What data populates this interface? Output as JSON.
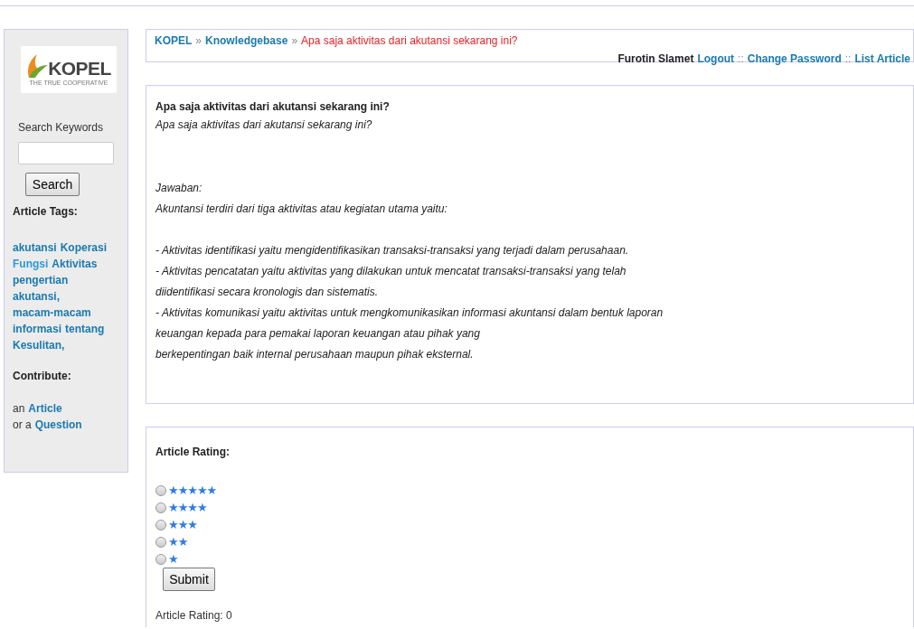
{
  "sidebar": {
    "logo": {
      "name": "KOPEL",
      "tagline": "THE TRUE COOPERATIVE"
    },
    "search": {
      "label": "Search Keywords",
      "button": "Search"
    },
    "tags_heading": "Article Tags:",
    "tags": [
      {
        "label": "akutansi",
        "color": "#1a7ab0"
      },
      {
        "label": "Koperasi",
        "color": "#1a7ab0"
      },
      {
        "label": "Fungsi",
        "color": "#2b9ad6"
      },
      {
        "label": "Aktivitas",
        "color": "#1a7ab0"
      },
      {
        "label": "pengertian",
        "color": "#1a7ab0"
      },
      {
        "label": "akutansi,",
        "color": "#1a7ab0"
      },
      {
        "label": "macam-macam",
        "color": "#1a7ab0"
      },
      {
        "label": "informasi",
        "color": "#1a7ab0"
      },
      {
        "label": "tentang",
        "color": "#1a7ab0"
      },
      {
        "label": "Kesulitan,",
        "color": "#1a7ab0"
      }
    ],
    "contribute_heading": "Contribute:",
    "contribute": [
      {
        "prefix": "an",
        "link": "Article"
      },
      {
        "prefix": "or a",
        "link": "Question"
      }
    ]
  },
  "breadcrumb": [
    {
      "label": "KOPEL",
      "kind": "link"
    },
    {
      "label": "»",
      "kind": "sep"
    },
    {
      "label": "Knowledgebase",
      "kind": "link"
    },
    {
      "label": "»",
      "kind": "sep"
    },
    {
      "label": "Apa saja aktivitas dari akutansi sekarang ini?",
      "kind": "current"
    }
  ],
  "user_bar": [
    {
      "label": "Furotin Slamet",
      "kind": "user"
    },
    {
      "label": "Logout",
      "kind": "link"
    },
    {
      "label": "::",
      "kind": "sep"
    },
    {
      "label": "Change Password",
      "kind": "link"
    },
    {
      "label": "::",
      "kind": "sep"
    },
    {
      "label": "List Article",
      "kind": "link"
    }
  ],
  "article": {
    "title": "Apa saja aktivitas dari akutansi sekarang ini?",
    "question": "Apa saja aktivitas dari akutansi sekarang ini?",
    "answer_intro": [
      "Jawaban:",
      "Akuntansi terdiri dari tiga aktivitas atau kegiatan utama yaitu:"
    ],
    "answer_lines": [
      "- Aktivitas identifikasi yaitu mengidentifikasikan transaksi-transaksi yang terjadi dalam perusahaan.",
      "- Aktivitas pencatatan yaitu aktivitas yang dilakukan untuk mencatat transaksi-transaksi yang telah",
      "diidentifikasi secara kronologis dan sistematis.",
      "- Aktivitas komunikasi yaitu aktivitas untuk mengkomunikasikan informasi akuntansi dalam bentuk laporan",
      "keuangan kepada para pemakai laporan keuangan atau pihak yang",
      "berkepentingan baik internal perusahaan maupun pihak eksternal."
    ]
  },
  "rating": {
    "heading": "Article Rating:",
    "options": [
      {
        "label": "★★★★★",
        "selected": false
      },
      {
        "label": "★★★★",
        "selected": false
      },
      {
        "label": "★★★",
        "selected": false
      },
      {
        "label": "★★",
        "selected": false
      },
      {
        "label": "★",
        "selected": false
      }
    ],
    "button": "Submit",
    "result": "Article Rating: 0"
  }
}
